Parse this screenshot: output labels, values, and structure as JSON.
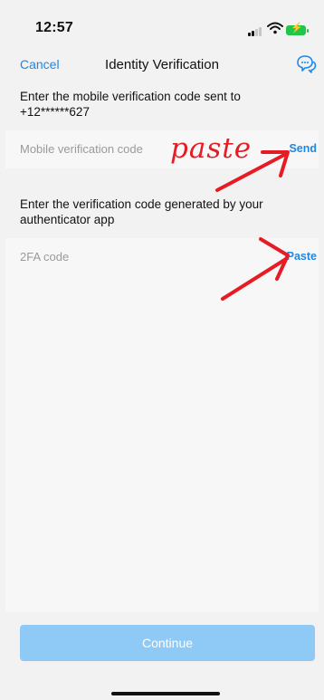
{
  "status_bar": {
    "time": "12:57"
  },
  "nav": {
    "cancel_label": "Cancel",
    "title": "Identity Verification",
    "chat_icon": "chat-bubbles-icon"
  },
  "mobile_section": {
    "instruction": "Enter the mobile verification code sent to +12******627",
    "field_placeholder": "Mobile verification code",
    "action_label": "Send"
  },
  "twofa_section": {
    "instruction": "Enter the verification code generated by your authenticator app",
    "field_placeholder": "2FA code",
    "action_label": "Paste"
  },
  "annotation": {
    "handwritten_text": "paste",
    "color": "#e51c23"
  },
  "footer": {
    "continue_label": "Continue",
    "continue_color": "#8fcaf6"
  },
  "colors": {
    "accent": "#1e88e5",
    "battery": "#20c54a"
  }
}
